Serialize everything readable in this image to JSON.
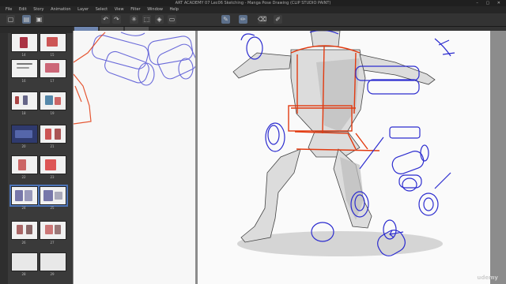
{
  "app": {
    "title": "ART ACADEMY 07 Lec06 Sketching - Manga Pose Drawing (CLIP STUDIO PAINT)",
    "window_controls": "– ▢ ✕"
  },
  "menu": [
    "File",
    "Edit",
    "Story",
    "Animation",
    "Layer",
    "Select",
    "View",
    "Filter",
    "Window",
    "Help"
  ],
  "toolbar": {
    "tools": [
      {
        "icon": "new-icon",
        "glyph": "▢"
      },
      {
        "icon": "open-icon",
        "glyph": "▤"
      },
      {
        "icon": "save-icon",
        "glyph": "▣"
      },
      {
        "icon": "undo-icon",
        "glyph": "↶"
      },
      {
        "icon": "redo-icon",
        "glyph": "↷"
      },
      {
        "icon": "spinner-icon",
        "glyph": "✳"
      },
      {
        "icon": "transform-icon",
        "glyph": "⬚"
      },
      {
        "icon": "fill-icon",
        "glyph": "◈"
      },
      {
        "icon": "frame-icon",
        "glyph": "▭"
      },
      {
        "icon": "pen-icon",
        "glyph": "✎"
      },
      {
        "icon": "brush-icon",
        "glyph": "✏"
      },
      {
        "icon": "eraser-icon",
        "glyph": "⌫"
      },
      {
        "icon": "pencil-icon",
        "glyph": "✐"
      }
    ]
  },
  "pages": {
    "numbers": [
      "14",
      "15",
      "16",
      "17",
      "18",
      "19",
      "20",
      "21",
      "22",
      "23",
      "24",
      "25",
      "26",
      "27",
      "28",
      "29"
    ]
  },
  "watermark": "udemy",
  "colors": {
    "accent": "#4d74b8",
    "sketch_blue": "#2c2ccf",
    "sketch_red": "#e23a10"
  }
}
